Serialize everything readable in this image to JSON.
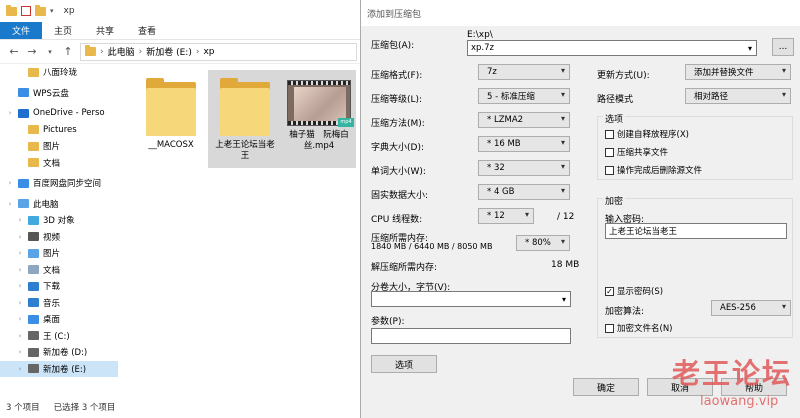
{
  "explorer": {
    "title": "xp",
    "ribbon_tabs": [
      "文件",
      "主页",
      "共享",
      "查看"
    ],
    "breadcrumb": [
      "此电脑",
      "新加卷 (E:)",
      "xp"
    ],
    "sidebar": [
      {
        "label": "八面玲珑",
        "icon": "folder-icon",
        "color": "#e8b84a"
      },
      {
        "label": "WPS云盘",
        "icon": "cloud-icon",
        "color": "#3a8ee6"
      },
      {
        "label": "OneDrive - Perso",
        "icon": "onedrive-icon",
        "color": "#1f6fd1"
      },
      {
        "label": "Pictures",
        "icon": "folder-icon",
        "color": "#e8b84a"
      },
      {
        "label": "图片",
        "icon": "folder-icon",
        "color": "#e8b84a"
      },
      {
        "label": "文档",
        "icon": "folder-icon",
        "color": "#e8b84a"
      },
      {
        "label": "百度网盘同步空间",
        "icon": "baidu-cloud-icon",
        "color": "#3a8ee6"
      },
      {
        "label": "此电脑",
        "icon": "computer-icon",
        "color": "#5aa3e6"
      },
      {
        "label": "3D 对象",
        "icon": "3d-objects-icon",
        "color": "#3fa9e0"
      },
      {
        "label": "视频",
        "icon": "video-icon",
        "color": "#555"
      },
      {
        "label": "图片",
        "icon": "pictures-icon",
        "color": "#5aa3e6"
      },
      {
        "label": "文档",
        "icon": "documents-icon",
        "color": "#8ea6bf"
      },
      {
        "label": "下载",
        "icon": "download-icon",
        "color": "#2f7fd0"
      },
      {
        "label": "音乐",
        "icon": "music-icon",
        "color": "#2f7fd0"
      },
      {
        "label": "桌面",
        "icon": "desktop-icon",
        "color": "#3a8ee6"
      },
      {
        "label": "王 (C:)",
        "icon": "drive-icon",
        "color": "#666"
      },
      {
        "label": "新加卷 (D:)",
        "icon": "drive-icon",
        "color": "#666"
      },
      {
        "label": "新加卷 (E:)",
        "icon": "drive-icon",
        "color": "#666"
      }
    ],
    "files": [
      {
        "name": "__MACOSX",
        "type": "folder"
      },
      {
        "name": "上老王论坛当老王",
        "type": "folder"
      },
      {
        "name": "柚子猫　阮梅白丝.mp4",
        "type": "video"
      }
    ],
    "status": {
      "count": "3 个项目",
      "selected": "已选择 3 个项目"
    }
  },
  "dialog": {
    "title": "添加到压缩包",
    "archive_label": "压缩包(A):",
    "archive_path": "E:\\xp\\",
    "archive_name": "xp.7z",
    "browse_label": "...",
    "format_label": "压缩格式(F):",
    "format_value": "7z",
    "level_label": "压缩等级(L):",
    "level_value": "5 - 标准压缩",
    "method_label": "压缩方法(M):",
    "method_value": "* LZMA2",
    "dict_label": "字典大小(D):",
    "dict_value": "* 16 MB",
    "word_label": "单词大小(W):",
    "word_value": "* 32",
    "solid_label": "固实数据大小:",
    "solid_value": "* 4 GB",
    "cpu_label": "CPU 线程数:",
    "cpu_value": "* 12",
    "cpu_max": "/ 12",
    "mem_label": "压缩所需内存:",
    "mem_detail": "1840 MB / 6440 MB / 8050 MB",
    "mem_percent": "* 80%",
    "decomp_label": "解压缩所需内存:",
    "decomp_value": "18 MB",
    "split_label": "分卷大小，字节(V):",
    "split_value": "",
    "params_label": "参数(P):",
    "params_value": "",
    "options_button": "选项",
    "update_label": "更新方式(U):",
    "update_value": "添加并替换文件",
    "pathmode_label": "路径模式",
    "pathmode_value": "相对路径",
    "options_group": "选项",
    "opt_sfx": "创建自释放程序(X)",
    "opt_shared": "压缩共享文件",
    "opt_delete": "操作完成后删除源文件",
    "encrypt_group": "加密",
    "password_label": "输入密码:",
    "password_value": "上老王论坛当老王",
    "show_password": "显示密码(S)",
    "enc_method_label": "加密算法:",
    "enc_method_value": "AES-256",
    "enc_names": "加密文件名(N)",
    "ok": "确定",
    "cancel": "取消",
    "help": "帮助"
  },
  "watermark": {
    "cn": "老王论坛",
    "en": "laowang.vip"
  }
}
